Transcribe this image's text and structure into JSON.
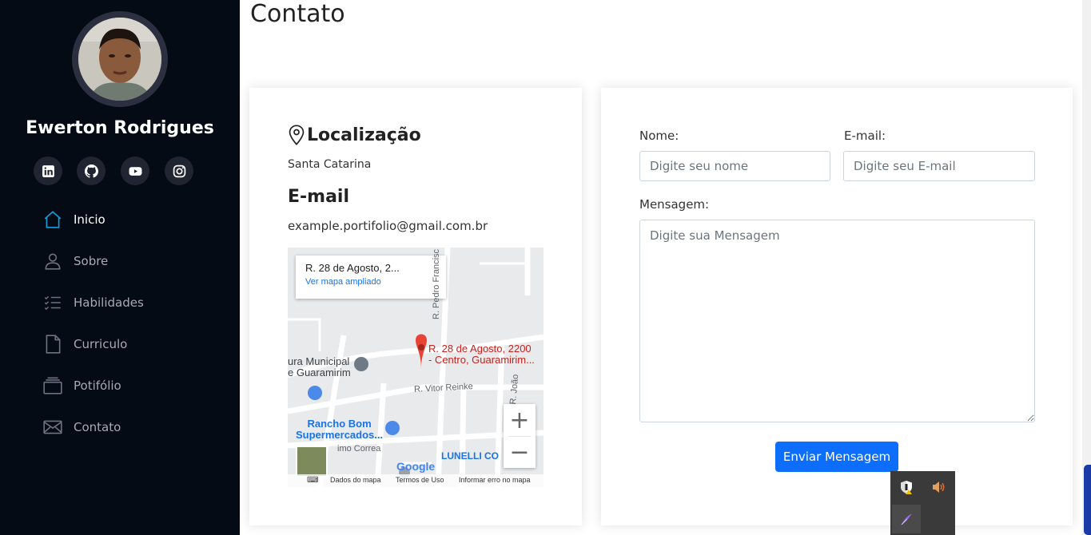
{
  "sidebar": {
    "name": "Ewerton Rodrigues",
    "social": [
      "linkedin-icon",
      "github-icon",
      "youtube-icon",
      "instagram-icon"
    ],
    "nav": [
      {
        "label": "Inicio",
        "icon": "home-icon",
        "active": true
      },
      {
        "label": "Sobre",
        "icon": "person-icon"
      },
      {
        "label": "Habilidades",
        "icon": "list-check-icon"
      },
      {
        "label": "Curriculo",
        "icon": "file-icon"
      },
      {
        "label": "Potifólio",
        "icon": "collection-icon"
      },
      {
        "label": "Contato",
        "icon": "envelope-icon"
      }
    ]
  },
  "main": {
    "title": "Contato",
    "info": {
      "location_title": "Localização",
      "location_value": "Santa Catarina",
      "email_title": "E-mail",
      "email_value": "example.portifolio@gmail.com.br"
    },
    "map": {
      "card_address": "R. 28 de Agosto, 2...",
      "card_link": "Ver mapa ampliado",
      "pin_label_1": "R. 28 de Agosto, 2200",
      "pin_label_2": "- Centro, Guaramirim...",
      "poi_1a": "ura Municipal",
      "poi_1b": "e Guaramirim",
      "street_1": "R. Vitor Reinke",
      "street_2": "R. Pedro Francisc",
      "street_3": "R. João",
      "poi_2a": "Rancho Bom",
      "poi_2b": "Supermercados...",
      "street_4": "imo Correa",
      "poi_3": "LUNELLI CO",
      "brand": "Google",
      "footer_data": "Dados do mapa",
      "footer_terms": "Termos de Uso",
      "footer_report": "Informar erro no mapa"
    },
    "form": {
      "name_label": "Nome:",
      "name_placeholder": "Digite seu nome",
      "email_label": "E-mail:",
      "email_placeholder": "Digite seu E-mail",
      "message_label": "Mensagem:",
      "message_placeholder": "Digite sua Mensagem",
      "send_label": "Enviar Mensagem"
    }
  },
  "colors": {
    "sidebar_bg": "#040b14",
    "accent": "#0d6efd",
    "active_icon": "#149ddd"
  }
}
